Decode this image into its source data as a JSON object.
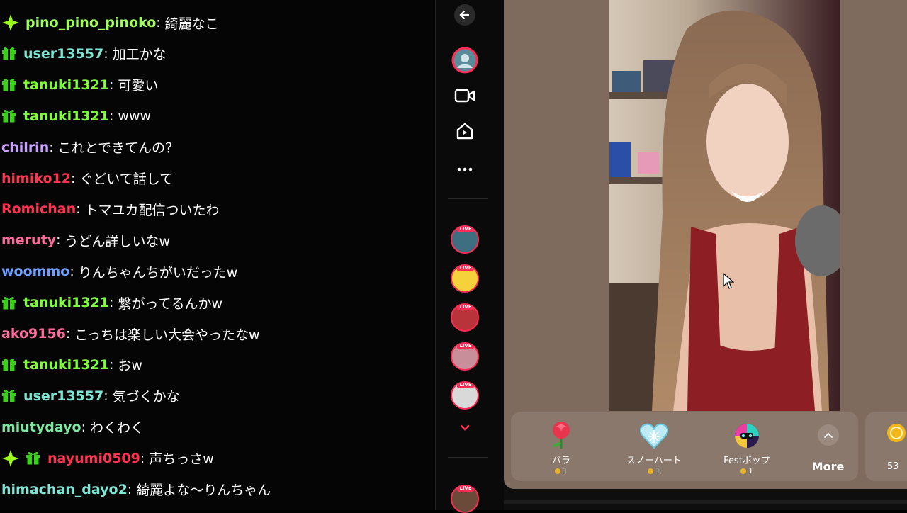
{
  "chat": {
    "messages": [
      {
        "user": "pino_pino_pinoko",
        "text": "綺麗なこ",
        "color": "#9cff57",
        "badges": [
          "star"
        ]
      },
      {
        "user": "user13557",
        "text": "加工かな",
        "color": "#7ee6d4",
        "badges": [
          "gift"
        ]
      },
      {
        "user": "tanuki1321",
        "text": "可愛い",
        "color": "#7fff3a",
        "badges": [
          "gift"
        ]
      },
      {
        "user": "tanuki1321",
        "text": "www",
        "color": "#7fff3a",
        "badges": [
          "gift"
        ]
      },
      {
        "user": "chilrin",
        "text": "これとできてんの？",
        "color": "#c9a0ff",
        "badges": []
      },
      {
        "user": "himiko12",
        "text": "ぐどいて話して",
        "color": "#ff3350",
        "badges": []
      },
      {
        "user": "Romichan",
        "text": "トマユカ配信ついたわ",
        "color": "#ff3350",
        "badges": []
      },
      {
        "user": "meruty",
        "text": "うどん詳しいなw",
        "color": "#ff6b9c",
        "badges": []
      },
      {
        "user": "woommo",
        "text": "りんちゃんちがいだったw",
        "color": "#6fa0ff",
        "badges": []
      },
      {
        "user": "tanuki1321",
        "text": "繋がってるんかw",
        "color": "#7fff3a",
        "badges": [
          "gift"
        ]
      },
      {
        "user": "ako9156",
        "text": "こっちは楽しい大会やったなw",
        "color": "#ff6b9c",
        "badges": []
      },
      {
        "user": "tanuki1321",
        "text": "おw",
        "color": "#7fff3a",
        "badges": [
          "gift"
        ]
      },
      {
        "user": "user13557",
        "text": "気づくかな",
        "color": "#7ee6d4",
        "badges": [
          "gift"
        ]
      },
      {
        "user": "miutydayo",
        "text": "わくわく",
        "color": "#7ee6a0",
        "badges": []
      },
      {
        "user": "nayumi0509",
        "text": "声ちっさw",
        "color": "#ff3350",
        "badges": [
          "star",
          "gift"
        ]
      },
      {
        "user": "himachan_dayo2",
        "text": "綺麗よな〜りんちゃん",
        "color": "#7ee6d4",
        "badges": []
      }
    ]
  },
  "rail": {
    "top_buttons": [
      "back-arrow-icon",
      "profile-avatar",
      "video-camera-icon",
      "live-house-icon",
      "more-dots-icon"
    ],
    "live_tag": "LIVE",
    "live_avatars_count_visible": 6
  },
  "gifts": {
    "items": [
      {
        "name": "バラ",
        "price": "1",
        "icon": "rose-icon"
      },
      {
        "name": "スノーハート",
        "price": "1",
        "icon": "snow-heart-icon"
      },
      {
        "name": "Festポップ",
        "price": "1",
        "icon": "fest-pop-icon"
      }
    ],
    "more_label": "More",
    "next_card_price": "53"
  },
  "colors": {
    "stage_bg": "#7e6b5e",
    "gift_panel": "#8a786c",
    "live_red": "#ff2c55",
    "star_badge": "#9cff1a",
    "gift_badge": "#3bd11a"
  }
}
